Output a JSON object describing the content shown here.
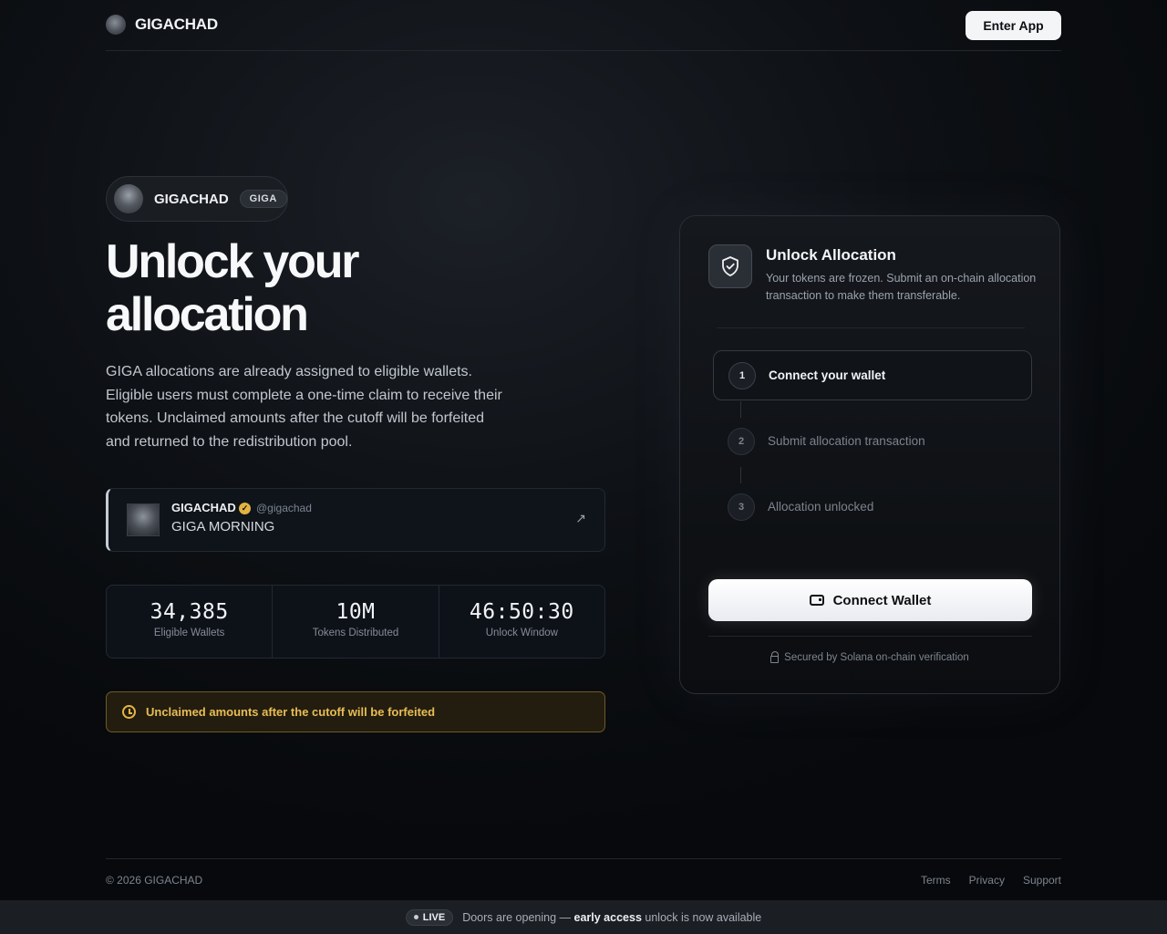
{
  "header": {
    "brand_name": "GIGACHAD",
    "enter_app_label": "Enter App"
  },
  "hero": {
    "token_name": "GIGACHAD",
    "token_ticker": "GIGA",
    "title": "Unlock your allocation",
    "description": "GIGA allocations are already assigned to eligible wallets. Eligible users must complete a one-time claim to receive their tokens. Unclaimed amounts after the cutoff will be forfeited and returned to the redistribution pool."
  },
  "tweet": {
    "name": "GIGACHAD",
    "handle": "@gigachad",
    "text": "GIGA MORNING",
    "verified_icon": "verified-badge-icon",
    "link_icon": "arrow-up-right-icon"
  },
  "stats": [
    {
      "value": "34,385",
      "label": "Eligible Wallets"
    },
    {
      "value": "10M",
      "label": "Tokens Distributed"
    },
    {
      "value": "46:50:30",
      "label": "Unlock Window"
    }
  ],
  "warning": {
    "text": "Unclaimed amounts after the cutoff will be forfeited",
    "icon": "clock-icon",
    "color": "#e9bd55"
  },
  "card": {
    "icon": "shield-check-icon",
    "title": "Unlock Allocation",
    "subtitle": "Your tokens are frozen. Submit an on-chain allocation transaction to make them transferable.",
    "steps": [
      {
        "number": "1",
        "label": "Connect your wallet",
        "active": true
      },
      {
        "number": "2",
        "label": "Submit allocation transaction",
        "active": false
      },
      {
        "number": "3",
        "label": "Allocation unlocked",
        "active": false
      }
    ],
    "connect_button_label": "Connect Wallet",
    "secured_text": "Secured by Solana on-chain verification"
  },
  "footer": {
    "copyright": "© 2026 GIGACHAD",
    "links": [
      "Terms",
      "Privacy",
      "Support"
    ]
  },
  "live_bar": {
    "badge": "LIVE",
    "text_before": "Doors are opening —",
    "text_bold": "early access",
    "text_after": "unlock is now available"
  }
}
